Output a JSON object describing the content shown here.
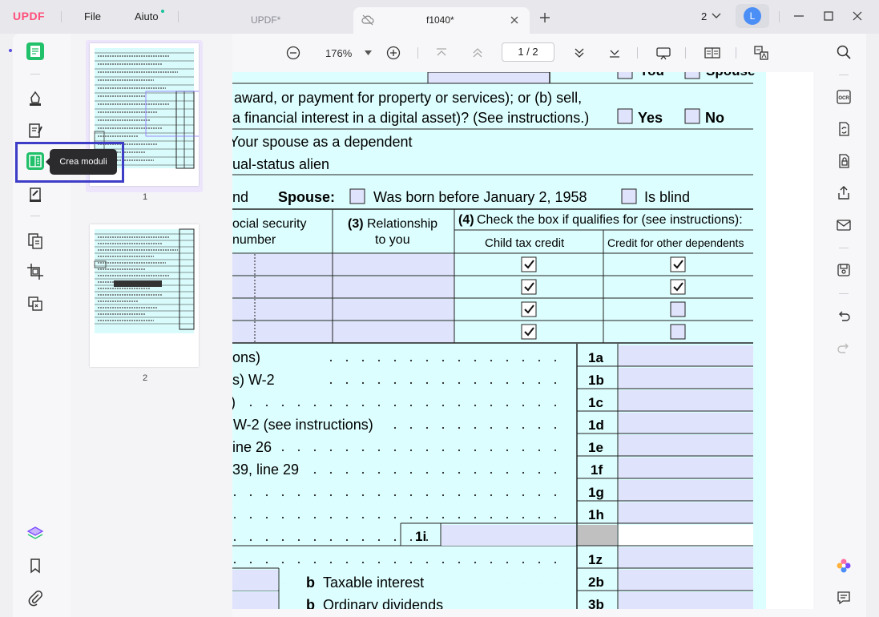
{
  "app": {
    "logo": "UPDF",
    "menu_file": "File",
    "menu_help": "Aiuto"
  },
  "tabs": [
    {
      "label": "UPDF*",
      "active": false
    },
    {
      "label": "f1040*",
      "active": true
    }
  ],
  "titlebar": {
    "window_count": "2",
    "user_initial": "L"
  },
  "toolbar": {
    "zoom": "176%",
    "page_indicator": "1 / 2"
  },
  "thumbnails": [
    {
      "label": "1"
    },
    {
      "label": "2"
    }
  ],
  "tooltip": {
    "text": "Crea moduli"
  },
  "form": {
    "lines": {
      "top_you": "You",
      "top_spouse": "Spouse",
      "digital_asset_1": "award, or payment for property or services); or (b) sell,",
      "digital_asset_2": "a financial interest in a digital asset)? (See instructions.)",
      "yes": "Yes",
      "no": "No",
      "dependent": "Your spouse as a dependent",
      "dual_status": "ual-status alien",
      "nd": "nd",
      "spouse_label": "Spouse:",
      "born_before": "Was born before January 2, 1958",
      "is_blind": "Is blind"
    },
    "dependents": {
      "col2_a": "ocial security",
      "col2_b": "number",
      "col3_num": "(3)",
      "col3_a": "Relationship",
      "col3_b": "to you",
      "col4_num": "(4)",
      "col4_title": "Check the box if qualifies for (see instructions):",
      "col4_child": "Child tax credit",
      "col4_other": "Credit for other dependents",
      "rows": [
        {
          "child": true,
          "other": true
        },
        {
          "child": true,
          "other": true
        },
        {
          "child": true,
          "other": false
        },
        {
          "child": true,
          "other": false
        }
      ]
    },
    "income": [
      {
        "text": "ons)",
        "line": "1a"
      },
      {
        "text": "s) W-2",
        "line": "1b"
      },
      {
        "text": ")",
        "line": "1c"
      },
      {
        "text": "W-2 (see instructions)",
        "line": "1d"
      },
      {
        "text": "ine 26",
        "line": "1e"
      },
      {
        "text": "39, line 29",
        "line": "1f"
      },
      {
        "text": "",
        "line": "1g"
      },
      {
        "text": "",
        "line": "1h"
      },
      {
        "text": "",
        "line": ""
      },
      {
        "text": "",
        "line": "1z"
      },
      {
        "text": "Taxable interest",
        "line": "2b",
        "prefix": "b"
      },
      {
        "text": "Ordinary dividends",
        "line": "3b",
        "prefix": "b"
      }
    ],
    "line_1i": "1i"
  }
}
